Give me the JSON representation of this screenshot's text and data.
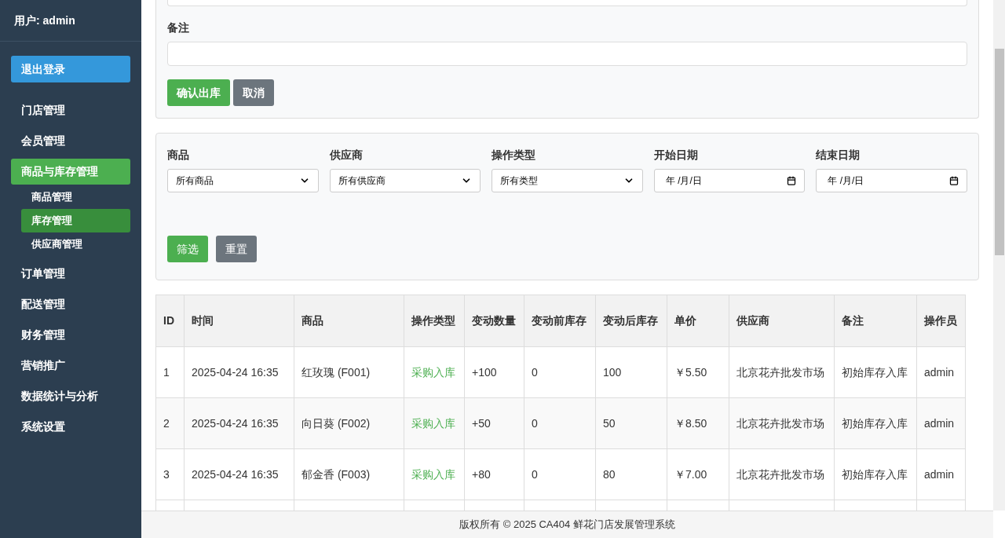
{
  "sidebar": {
    "user": "用户: admin",
    "logout": "退出登录",
    "menu": [
      {
        "label": "门店管理",
        "selected": false
      },
      {
        "label": "会员管理",
        "selected": false
      },
      {
        "label": "商品与库存管理",
        "selected": true,
        "children": [
          {
            "label": "商品管理",
            "selected": false
          },
          {
            "label": "库存管理",
            "selected": true
          },
          {
            "label": "供应商管理",
            "selected": false
          }
        ]
      },
      {
        "label": "订单管理",
        "selected": false
      },
      {
        "label": "配送管理",
        "selected": false
      },
      {
        "label": "财务管理",
        "selected": false
      },
      {
        "label": "营销推广",
        "selected": false
      },
      {
        "label": "数据统计与分析",
        "selected": false
      },
      {
        "label": "系统设置",
        "selected": false
      }
    ]
  },
  "out_form": {
    "remark_label": "备注",
    "confirm": "确认出库",
    "cancel": "取消"
  },
  "filters": {
    "fields": [
      {
        "kind": "select",
        "label": "商品",
        "value": "所有商品"
      },
      {
        "kind": "select",
        "label": "供应商",
        "value": "所有供应商"
      },
      {
        "kind": "select",
        "label": "操作类型",
        "value": "所有类型"
      },
      {
        "kind": "date",
        "label": "开始日期",
        "value": "年 /月/日"
      },
      {
        "kind": "date",
        "label": "结束日期",
        "value": "年 /月/日"
      }
    ],
    "apply": "筛选",
    "reset": "重置"
  },
  "table": {
    "columns": [
      "ID",
      "时间",
      "商品",
      "操作类型",
      "变动数量",
      "变动前库存",
      "变动后库存",
      "单价",
      "供应商",
      "备注",
      "操作员"
    ],
    "rows": [
      {
        "kind": "in",
        "cells": [
          "1",
          "2025-04-24 16:35",
          "红玫瑰 (F001)",
          "采购入库",
          "+100",
          "0",
          "100",
          "￥5.50",
          "北京花卉批发市场",
          "初始库存入库",
          "admin"
        ]
      },
      {
        "kind": "in",
        "cells": [
          "2",
          "2025-04-24 16:35",
          "向日葵 (F002)",
          "采购入库",
          "+50",
          "0",
          "50",
          "￥8.50",
          "北京花卉批发市场",
          "初始库存入库",
          "admin"
        ]
      },
      {
        "kind": "in",
        "cells": [
          "3",
          "2025-04-24 16:35",
          "郁金香 (F003)",
          "采购入库",
          "+80",
          "0",
          "80",
          "￥7.00",
          "北京花卉批发市场",
          "初始库存入库",
          "admin"
        ]
      }
    ]
  },
  "footer": "版权所有 © 2025 CA404 鲜花门店发展管理系统"
}
